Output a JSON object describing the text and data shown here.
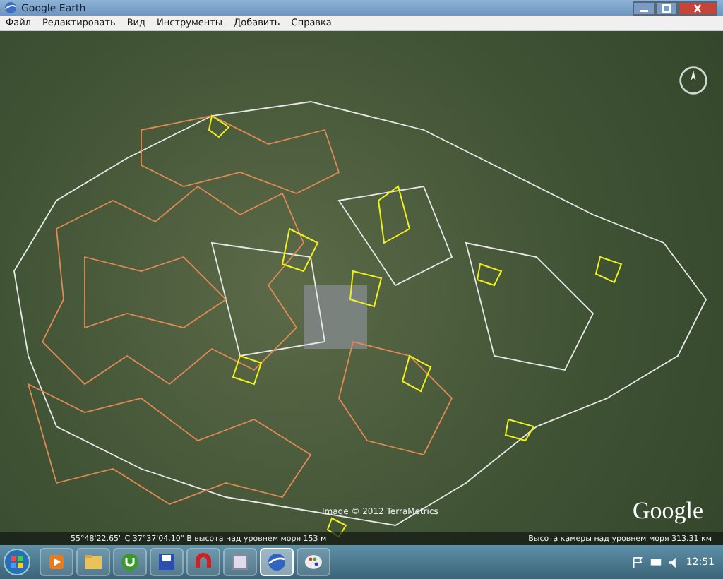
{
  "window": {
    "title": "Google Earth"
  },
  "menu": [
    "Файл",
    "Редактировать",
    "Вид",
    "Инструменты",
    "Добавить",
    "Справка"
  ],
  "map": {
    "attribution": "Image © 2012 TerraMetrics",
    "logo": "Google",
    "status_left": "55°48'22.65\" С 37°37'04.10\" В   высота над уровнем моря 153 м",
    "status_right": "Высота камеры над уровнем моря  313.31 км"
  },
  "taskbar": {
    "apps": [
      {
        "kind": "media",
        "selected": false
      },
      {
        "kind": "folder",
        "selected": false
      },
      {
        "kind": "torrent",
        "selected": false
      },
      {
        "kind": "floppy",
        "selected": false
      },
      {
        "kind": "magnet",
        "selected": false
      },
      {
        "kind": "blank",
        "selected": false
      },
      {
        "kind": "earth",
        "selected": true
      },
      {
        "kind": "paint",
        "selected": false
      }
    ],
    "time": "12:51"
  }
}
